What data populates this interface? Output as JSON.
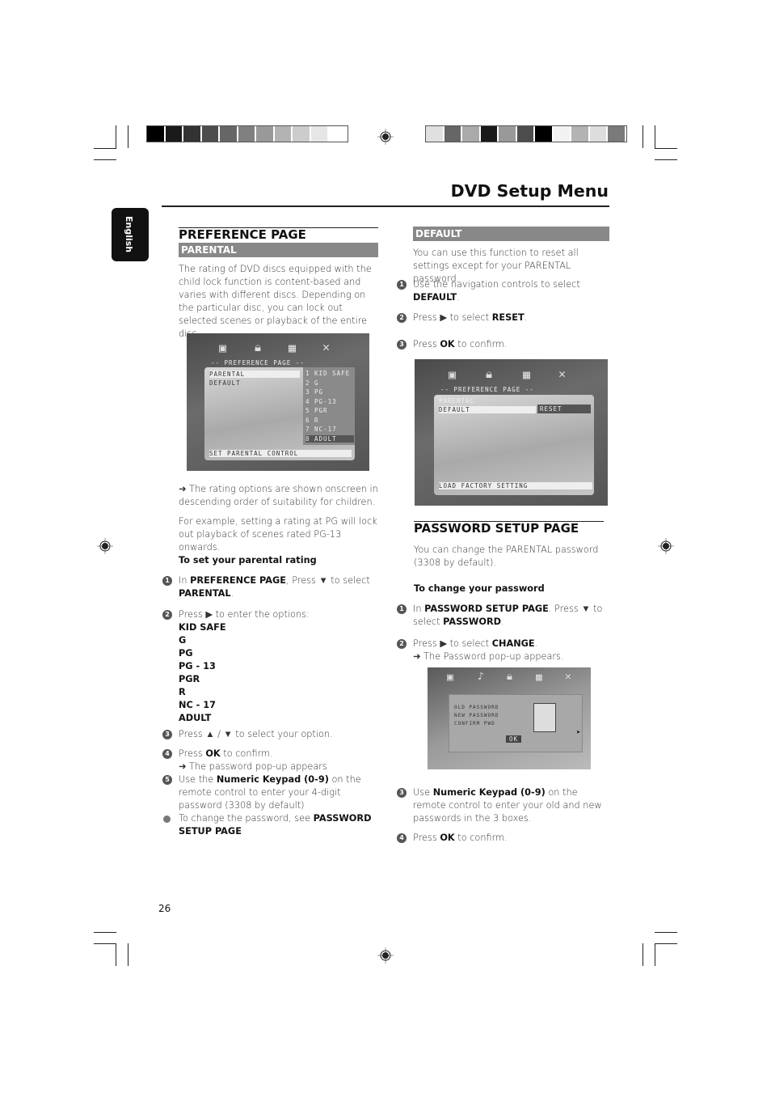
{
  "header": {
    "title": "DVD Setup Menu",
    "language_tab": "English",
    "page_number": "26"
  },
  "colors": {
    "accent_bar": "#888888",
    "text": "#333333"
  },
  "color_bars": {
    "left": [
      "#000000",
      "#1a1a1a",
      "#333333",
      "#4d4d4d",
      "#666666",
      "#808080",
      "#999999",
      "#b3b3b3",
      "#cccccc",
      "#e6e6e6",
      "#ffffff"
    ],
    "right": [
      "#e0e0e0",
      "#666666",
      "#aaaaaa",
      "#1a1a1a",
      "#999999",
      "#4d4d4d",
      "#000000",
      "#f2f2f2",
      "#b3b3b3",
      "#dddddd",
      "#7a7a7a"
    ]
  },
  "left": {
    "section_title": "PREFERENCE PAGE",
    "subheading": "PARENTAL",
    "intro": "The rating of DVD discs equipped with the child lock function is content-based and varies with different discs. Depending on the particular disc, you can lock out selected scenes or playback of the entire disc.",
    "screen": {
      "header": "-- PREFERENCE PAGE --",
      "menu": [
        "PARENTAL",
        "DEFAULT"
      ],
      "options": [
        "1 KID SAFE",
        "2 G",
        "3 PG",
        "4 PG-13",
        "5 PGR",
        "6 R",
        "7 NC-17",
        "8 ADULT"
      ],
      "footer": "SET PARENTAL CONTROL"
    },
    "note1": "➜ The rating options are shown onscreen in descending order of suitability for children.",
    "note2": "For example, setting a rating at PG will lock out playback of scenes rated PG-13 onwards.",
    "procedure_title": "To set your parental rating",
    "steps": [
      {
        "marker": "1",
        "segments": [
          [
            "t",
            "In "
          ],
          [
            "b",
            "PREFERENCE PAGE"
          ],
          [
            "t",
            ", Press ▼ to select "
          ],
          [
            "br"
          ],
          [
            "b",
            "PARENTAL"
          ],
          [
            "t",
            "."
          ]
        ]
      },
      {
        "marker": "2",
        "segments": [
          [
            "t",
            "Press  ▶  to enter the options:"
          ],
          [
            "br"
          ],
          [
            "b",
            "KID SAFE"
          ],
          [
            "br"
          ],
          [
            "b",
            "G"
          ],
          [
            "br"
          ],
          [
            "b",
            "PG"
          ],
          [
            "br"
          ],
          [
            "b",
            "PG - 13"
          ],
          [
            "br"
          ],
          [
            "b",
            "PGR"
          ],
          [
            "br"
          ],
          [
            "b",
            "R"
          ],
          [
            "br"
          ],
          [
            "b",
            "NC - 17"
          ],
          [
            "br"
          ],
          [
            "b",
            "ADULT"
          ]
        ]
      },
      {
        "marker": "3",
        "segments": [
          [
            "t",
            "Press  ▲  /  ▼ to select your option."
          ]
        ]
      },
      {
        "marker": "4",
        "segments": [
          [
            "t",
            "Press "
          ],
          [
            "b",
            "OK"
          ],
          [
            "t",
            " to confirm."
          ],
          [
            "br"
          ],
          [
            "t",
            "➜ The password pop-up appears"
          ]
        ]
      },
      {
        "marker": "5",
        "segments": [
          [
            "t",
            "Use the  "
          ],
          [
            "b",
            "Numeric Keypad (0-9)"
          ],
          [
            "t",
            " on the remote control to enter your 4-digit password (3308 by default)"
          ]
        ]
      },
      {
        "marker": "●",
        "segments": [
          [
            "t",
            "To change the password, see "
          ],
          [
            "b",
            "PASSWORD SETUP PAGE"
          ]
        ]
      }
    ]
  },
  "right": {
    "default_title": "DEFAULT",
    "default_intro": "You can use this function to reset all settings except for your PARENTAL password.",
    "default_steps": [
      {
        "marker": "1",
        "segments": [
          [
            "t",
            "Use the navigation controls to select "
          ],
          [
            "br"
          ],
          [
            "b",
            "DEFAULT"
          ],
          [
            "t",
            "."
          ]
        ]
      },
      {
        "marker": "2",
        "segments": [
          [
            "t",
            "Press ▶  to select "
          ],
          [
            "b",
            "RESET"
          ],
          [
            "t",
            "."
          ]
        ]
      },
      {
        "marker": "3",
        "segments": [
          [
            "t",
            "Press "
          ],
          [
            "b",
            "OK"
          ],
          [
            "t",
            " to confirm."
          ]
        ]
      }
    ],
    "screen": {
      "header": "-- PREFERENCE PAGE --",
      "menu": [
        "PARENTAL",
        "DEFAULT"
      ],
      "option": "RESET",
      "footer": "LOAD FACTORY SETTING"
    },
    "password_title": "PASSWORD SETUP PAGE",
    "password_intro": "You can change the PARENTAL password (3308 by default).",
    "procedure_title": "To change your password",
    "password_steps": [
      {
        "marker": "1",
        "segments": [
          [
            "t",
            "In "
          ],
          [
            "b",
            "PASSWORD SETUP PAGE"
          ],
          [
            "t",
            ". Press ▼ to select "
          ],
          [
            "b",
            "PASSWORD"
          ],
          [
            "t",
            "."
          ]
        ]
      },
      {
        "marker": "2",
        "segments": [
          [
            "t",
            "Press  ▶ to select "
          ],
          [
            "b",
            "CHANGE"
          ],
          [
            "t",
            "."
          ],
          [
            "br"
          ],
          [
            "t",
            "➜ The Password pop-up appears."
          ]
        ]
      }
    ],
    "popup": {
      "fields": [
        "OLD PASSWORD",
        "NEW PASSWORD",
        "CONFIRM PWD"
      ],
      "ok": "OK"
    },
    "password_steps_after": [
      {
        "marker": "3",
        "segments": [
          [
            "t",
            "Use "
          ],
          [
            "b",
            "Numeric Keypad (0-9)"
          ],
          [
            "t",
            " on the remote control to enter your old and new passwords in the 3 boxes."
          ]
        ]
      },
      {
        "marker": "4",
        "segments": [
          [
            "t",
            "Press "
          ],
          [
            "b",
            "OK"
          ],
          [
            "t",
            " to confirm."
          ]
        ]
      }
    ]
  }
}
